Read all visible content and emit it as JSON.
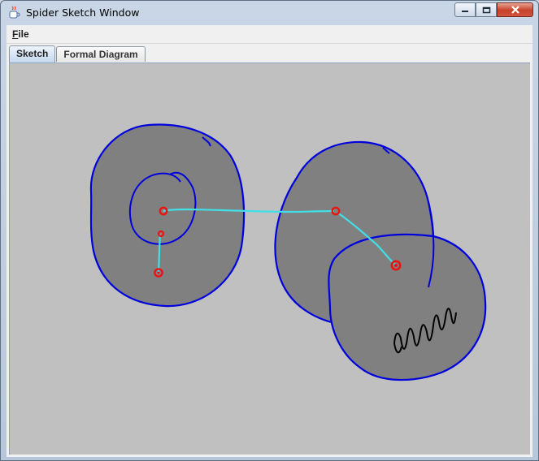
{
  "window": {
    "title": "Spider Sketch Window",
    "accent": "#c7402a"
  },
  "menu": {
    "file_label": "File",
    "file_mnemonic": "F",
    "file_rest": "ile"
  },
  "tabs": [
    {
      "label": "Sketch",
      "selected": true
    },
    {
      "label": "Formal Diagram",
      "selected": false
    }
  ],
  "sketch": {
    "background_color": "#c0c0c0",
    "region_fill": "#808080",
    "outline_color": "#0000dd",
    "connector_color": "#3fe0e8",
    "node_color": "#ee1111",
    "scribble_color": "#000000"
  },
  "icons": [
    "java-cup-icon",
    "minimize-icon",
    "maximize-icon",
    "close-icon"
  ]
}
